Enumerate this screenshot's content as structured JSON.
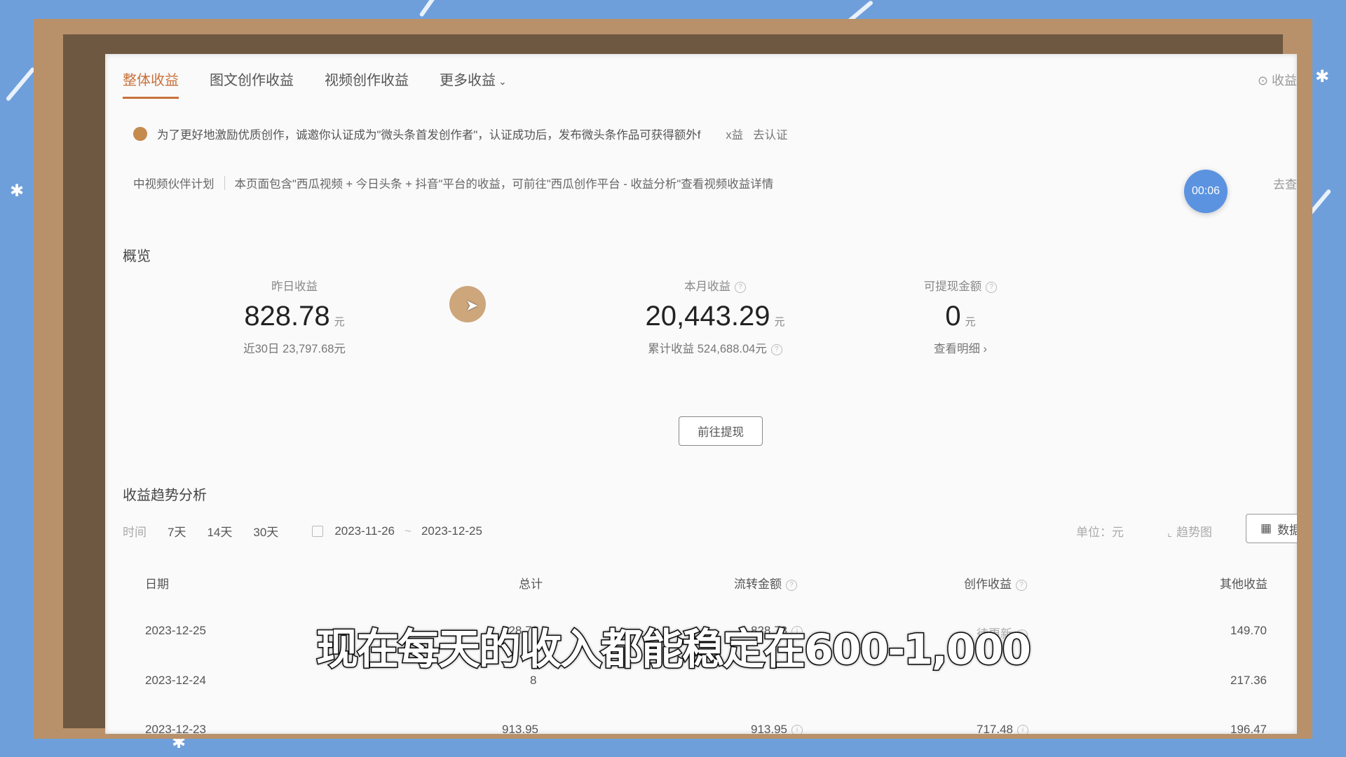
{
  "tabs": [
    {
      "label": "整体收益"
    },
    {
      "label": "图文创作收益"
    },
    {
      "label": "视频创作收益"
    },
    {
      "label": "更多收益"
    }
  ],
  "top_right_link": "⊙ 收益",
  "notice": {
    "text": "为了更好地激励优质创作，诚邀你认证成为\"微头条首发创作者\"，认证成功后，发布微头条作品可获得额外f",
    "link_partial": "x益",
    "link": "去认证"
  },
  "plan": {
    "name": "中视频伙伴计划",
    "text": "本页面包含\"西瓜视频 + 今日头条 + 抖音\"平台的收益，可前往\"西瓜创作平台 - 收益分析\"查看视频收益详情",
    "right_link": "去查"
  },
  "timer": "00:06",
  "overview": {
    "title": "概览",
    "yesterday": {
      "label": "昨日收益",
      "value": "828.78",
      "unit": "元",
      "sub": "近30日 23,797.68元"
    },
    "month": {
      "label": "本月收益",
      "value": "20,443.29",
      "unit": "元",
      "sub": "累计收益 524,688.04元"
    },
    "withdrawable": {
      "label": "可提现金额",
      "value": "0",
      "unit": "元",
      "sub": "查看明细 ›"
    },
    "withdraw_button": "前往提现"
  },
  "trend": {
    "title": "收益趋势分析",
    "time_label": "时间",
    "ranges": [
      "7天",
      "14天",
      "30天"
    ],
    "date_start": "2023-11-26",
    "date_sep": "~",
    "date_end": "2023-12-25",
    "unit": "单位：元",
    "trend_chart": "趋势图",
    "data_list": "数据列"
  },
  "table": {
    "headers": {
      "date": "日期",
      "total": "总计",
      "flow": "流转金额",
      "creation": "创作收益",
      "other": "其他收益"
    },
    "rows": [
      {
        "date": "2023-12-25",
        "total": "828.78",
        "flow": "828.78",
        "creation": "待更新",
        "other": "149.70"
      },
      {
        "date": "2023-12-24",
        "total": "8",
        "flow": "",
        "creation": "",
        "other": "217.36"
      },
      {
        "date": "2023-12-23",
        "total": "913.95",
        "flow": "913.95",
        "creation": "717.48",
        "other": "196.47"
      }
    ]
  },
  "subtitle": "现在每天的收入都能稳定在600-1,000"
}
